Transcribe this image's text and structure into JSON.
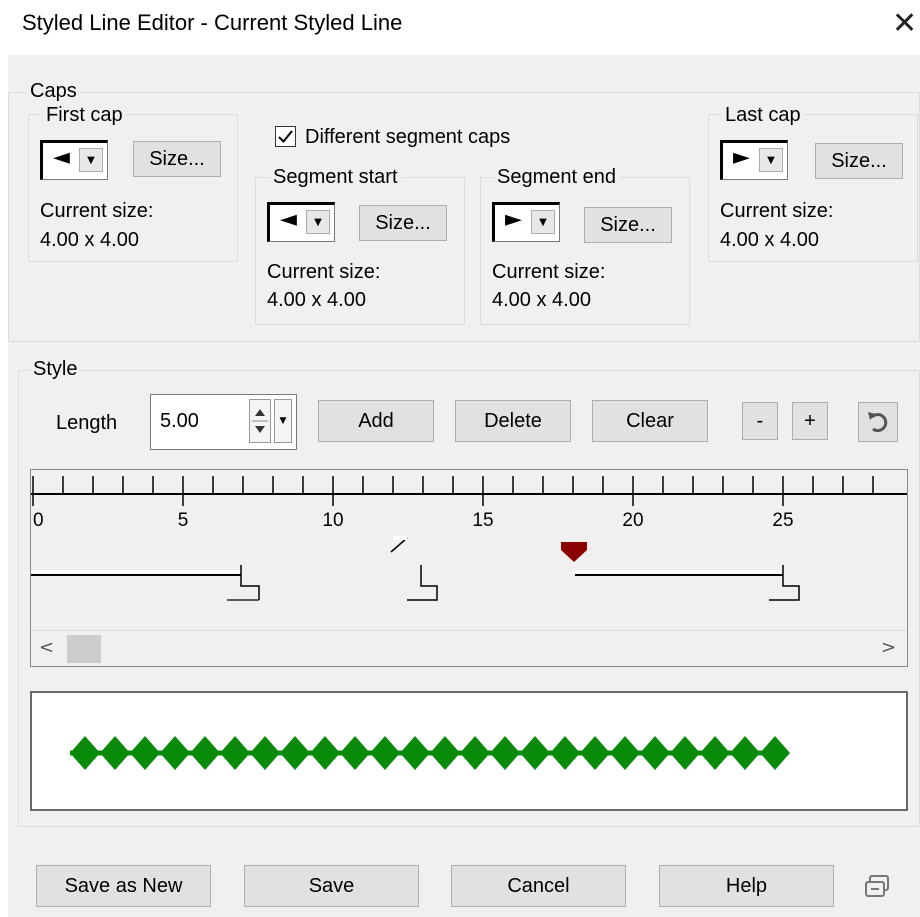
{
  "window": {
    "title": "Styled Line Editor -  Current Styled Line",
    "close_glyph": "✕"
  },
  "caps": {
    "group_label": "Caps",
    "first_cap": {
      "label": "First cap",
      "arrow_icon": "left-arrow-cap-icon",
      "size_button": "Size...",
      "current_size_label": "Current size:",
      "current_size_value": "4.00 x 4.00"
    },
    "different_segment_caps": {
      "label": "Different segment caps",
      "checked": true
    },
    "segment_start": {
      "label": "Segment start",
      "arrow_icon": "left-arrow-cap-icon",
      "size_button": "Size...",
      "current_size_label": "Current size:",
      "current_size_value": "4.00 x 4.00"
    },
    "segment_end": {
      "label": "Segment end",
      "arrow_icon": "right-arrow-cap-icon",
      "size_button": "Size...",
      "current_size_label": "Current size:",
      "current_size_value": "4.00 x 4.00"
    },
    "last_cap": {
      "label": "Last cap",
      "arrow_icon": "right-arrow-cap-icon",
      "size_button": "Size...",
      "current_size_label": "Current size:",
      "current_size_value": "4.00 x 4.00"
    }
  },
  "style": {
    "group_label": "Style",
    "length_label": "Length",
    "length_value": "5.00",
    "add_button": "Add",
    "delete_button": "Delete",
    "clear_button": "Clear",
    "minus_button": "-",
    "plus_button": "+",
    "reset_icon": "reset-icon",
    "ruler_ticks": [
      "0",
      "5",
      "10",
      "15",
      "20",
      "25"
    ],
    "scroll_left": "<",
    "scroll_right": ">",
    "marker_color": "#8b0000",
    "preview_color": "#0a8a0a"
  },
  "footer": {
    "save_as_new": "Save as New",
    "save": "Save",
    "cancel": "Cancel",
    "help": "Help",
    "sync_icon": "link-icon"
  }
}
